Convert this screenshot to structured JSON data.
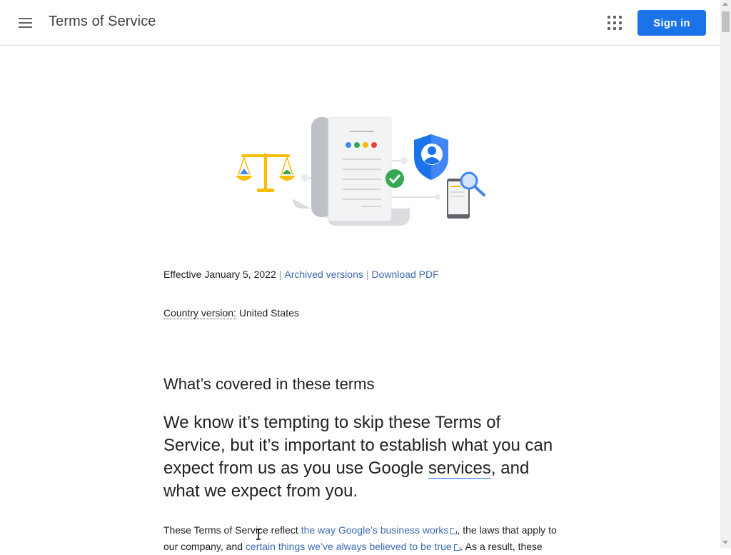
{
  "header": {
    "title": "Terms of Service",
    "sign_in_label": "Sign in",
    "menu_icon": "hamburger-menu-icon",
    "apps_icon": "apps-grid-icon"
  },
  "meta": {
    "effective": "Effective January 5, 2022",
    "separator": "|",
    "archived_label": "Archived versions",
    "download_label": "Download PDF",
    "country_label": "Country version:",
    "country_value": "United States"
  },
  "content": {
    "section_heading": "What’s covered in these terms",
    "lead_part1": "We know it’s tempting to skip these Terms of Service, but it’s important to establish what you can expect from us as you use Google ",
    "lead_link": "services",
    "lead_part2": ", and what we expect from you.",
    "body_part1": "These Terms of Service reflect ",
    "body_link1": "the way Google’s business works",
    "body_part2": ", the laws that apply to our company, and ",
    "body_link2": "certain things we’ve always believed to be true",
    "body_part3": ". As a result, these"
  },
  "colors": {
    "brand_blue": "#1a73e8",
    "link": "#3c6ab0",
    "google_blue": "#4285f4",
    "google_green": "#34a853",
    "google_yellow": "#fbbc04",
    "google_red": "#ea4335"
  }
}
